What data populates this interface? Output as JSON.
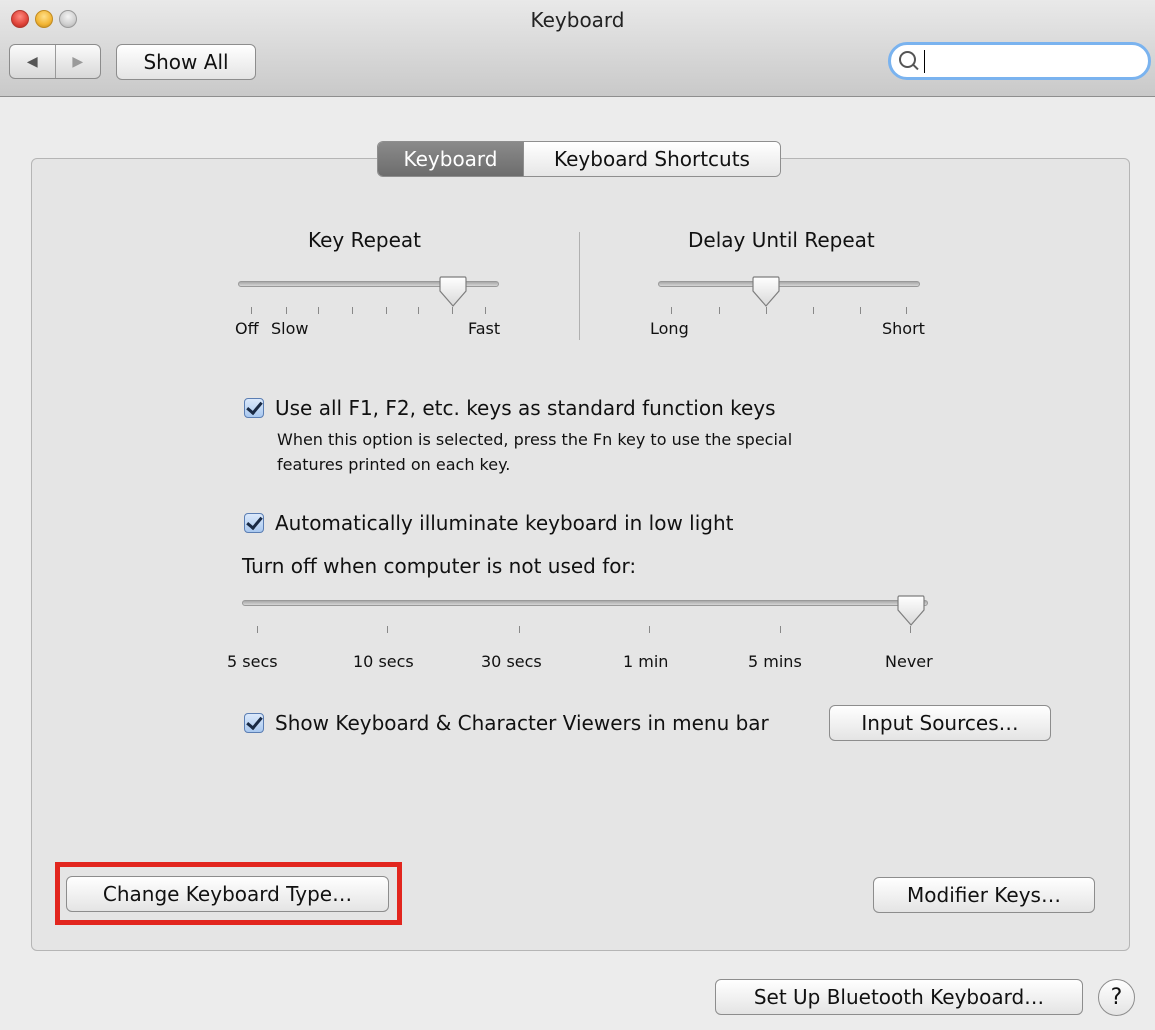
{
  "window": {
    "title": "Keyboard"
  },
  "toolbar": {
    "back_glyph": "◀",
    "forward_glyph": "▶",
    "show_all_label": "Show All",
    "search_value": "",
    "search_placeholder": ""
  },
  "tabs": [
    {
      "label": "Keyboard",
      "selected": true
    },
    {
      "label": "Keyboard Shortcuts",
      "selected": false
    }
  ],
  "key_repeat": {
    "title": "Key Repeat",
    "min_label": "Off",
    "slow_label": "Slow",
    "max_label": "Fast",
    "stops": 8,
    "value_index": 6
  },
  "delay_until_repeat": {
    "title": "Delay Until Repeat",
    "min_label": "Long",
    "max_label": "Short",
    "stops": 6,
    "value_index": 2
  },
  "function_keys": {
    "checked": true,
    "label": "Use all F1, F2, etc. keys as standard function keys",
    "description_line1": "When this option is selected, press the Fn key to use the special",
    "description_line2": "features printed on each key."
  },
  "illumination": {
    "checked": true,
    "label": "Automatically illuminate keyboard in low light",
    "turn_off_label": "Turn off when computer is not used for:",
    "ticks": [
      "5 secs",
      "10 secs",
      "30 secs",
      "1 min",
      "5 mins",
      "Never"
    ],
    "value_index": 5
  },
  "viewers": {
    "checked": true,
    "label": "Show Keyboard & Character Viewers in menu bar",
    "input_sources_label": "Input Sources…"
  },
  "buttons": {
    "change_keyboard_type": "Change Keyboard Type…",
    "modifier_keys": "Modifier Keys…",
    "bluetooth": "Set Up Bluetooth Keyboard…",
    "help": "?"
  },
  "colors": {
    "highlight": "#e2261e",
    "focus_ring": "#7ab3ef"
  }
}
